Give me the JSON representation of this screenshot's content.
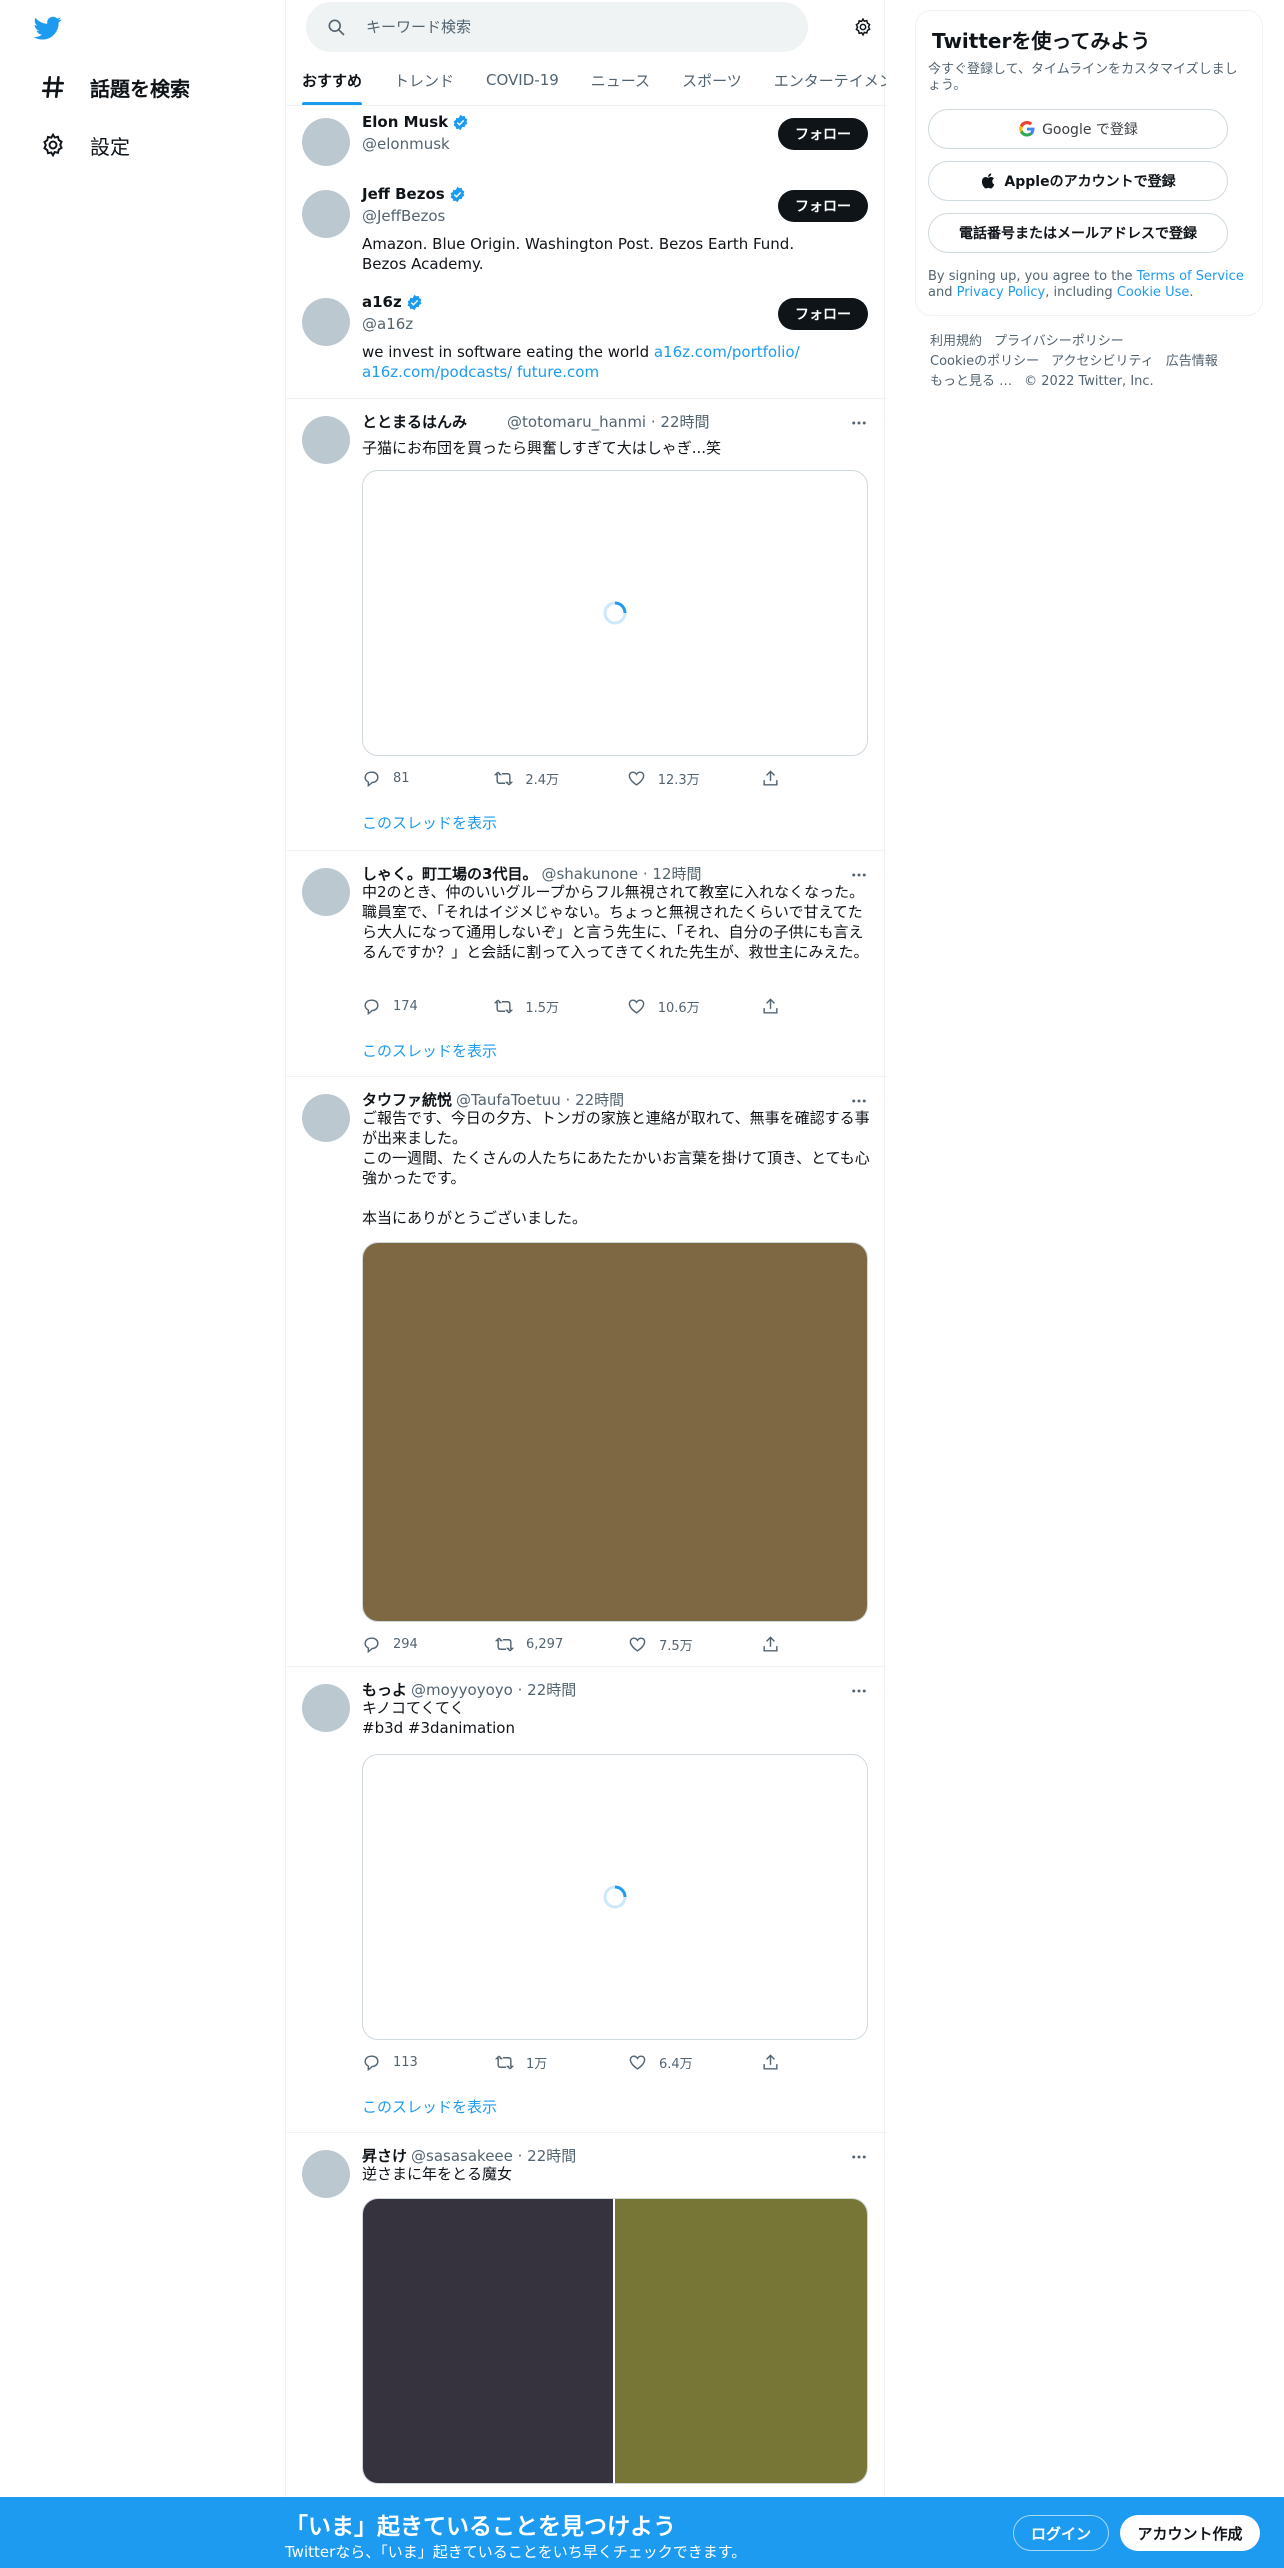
{
  "nav": {
    "items": [
      {
        "label": "話題を検索"
      },
      {
        "label": "設定"
      }
    ]
  },
  "search": {
    "placeholder": "キーワード検索"
  },
  "tabs": [
    "おすすめ",
    "トレンド",
    "COVID-19",
    "ニュース",
    "スポーツ",
    "エンターテイメント"
  ],
  "follow_label": "フォロー",
  "who_to_follow": [
    {
      "name": "Elon Musk",
      "handle": "@elonmusk",
      "bio_parts": []
    },
    {
      "name": "Jeff Bezos",
      "handle": "@JeffBezos",
      "bio_parts": [
        {
          "text": "Amazon. Blue Origin. Washington Post. Bezos Earth Fund. Bezos Academy.",
          "link": false
        }
      ]
    },
    {
      "name": "a16z",
      "handle": "@a16z",
      "bio_parts": [
        {
          "text": "we invest in software eating the world ",
          "link": false
        },
        {
          "text": "a16z.com/portfolio/",
          "link": true
        },
        {
          "text": "a16z.com/podcasts/",
          "link": true
        },
        {
          "text": " ",
          "link": false
        },
        {
          "text": "future.com",
          "link": true
        }
      ]
    }
  ],
  "thread_link_label": "このスレッドを表示",
  "tweets": [
    {
      "name": "ととまるはんみ",
      "meta": "@totomaru_hanmi · 22時間",
      "text": "子猫にお布団を買ったら興奮しすぎて大はしゃぎ...笑",
      "replies": "81",
      "retweets": "2.4万",
      "likes": "12.3万"
    },
    {
      "name": "しゃく。町工場の3代目。",
      "meta": "@shakunone · 12時間",
      "text": "中2のとき、仲のいいグループからフル無視されて教室に入れなくなった。職員室で、「それはイジメじゃない。ちょっと無視されたくらいで甘えてたら大人になって通用しないぞ」と言う先生に、「それ、自分の子供にも言えるんですか？」と会話に割って入ってきてくれた先生が、救世主にみえた。",
      "replies": "174",
      "retweets": "1.5万",
      "likes": "10.6万"
    },
    {
      "name": "タウファ統悦",
      "meta": "@TaufaToetuu · 22時間",
      "text": "ご報告です、今日の夕方、トンガの家族と連絡が取れて、無事を確認する事が出来ました。\nこの一週間、たくさんの人たちにあたたかいお言葉を掛けて頂き、とても心強かったです。\n\n本当にありがとうございました。",
      "replies": "294",
      "retweets": "6,297",
      "likes": "7.5万",
      "media_color": "#7e6843"
    },
    {
      "name": "もっよ",
      "meta": "@moyyoyoyo · 22時間",
      "text": "キノコてくてく",
      "hashtags": "#b3d #3danimation",
      "replies": "113",
      "retweets": "1万",
      "likes": "6.4万"
    },
    {
      "name": "昇さけ",
      "meta": "@sasasakeee · 22時間",
      "text": "逆さまに年をとる魔女",
      "media_colors": [
        "#36323e",
        "#777636"
      ]
    }
  ],
  "signup": {
    "title": "Twitterを使ってみよう",
    "subtitle": "今すぐ登録して、タイムラインをカスタマイズしましょう。",
    "google_label": "Google で登録",
    "apple_label": "Appleのアカウントで登録",
    "phone_label": "電話番号またはメールアドレスで登録",
    "legal_prefix": "By signing up, you agree to the ",
    "terms": "Terms of Service",
    "and": " and ",
    "privacy": "Privacy Policy",
    "including": ", including ",
    "cookie": "Cookie Use",
    "period": "."
  },
  "footer": {
    "links": [
      "利用規約",
      "プライバシーポリシー",
      "Cookieのポリシー",
      "アクセシビリティ",
      "広告情報",
      "もっと見る …"
    ],
    "copyright": "© 2022 Twitter, Inc."
  },
  "bottom_bar": {
    "headline": "「いま」起きていることを見つけよう",
    "subline": "Twitterなら、「いま」起きていることをいち早くチェックできます。",
    "login": "ログイン",
    "signup": "アカウント作成"
  },
  "colors": {
    "accent": "#1d9bf0",
    "text": "#0f1419",
    "muted": "#536471"
  }
}
